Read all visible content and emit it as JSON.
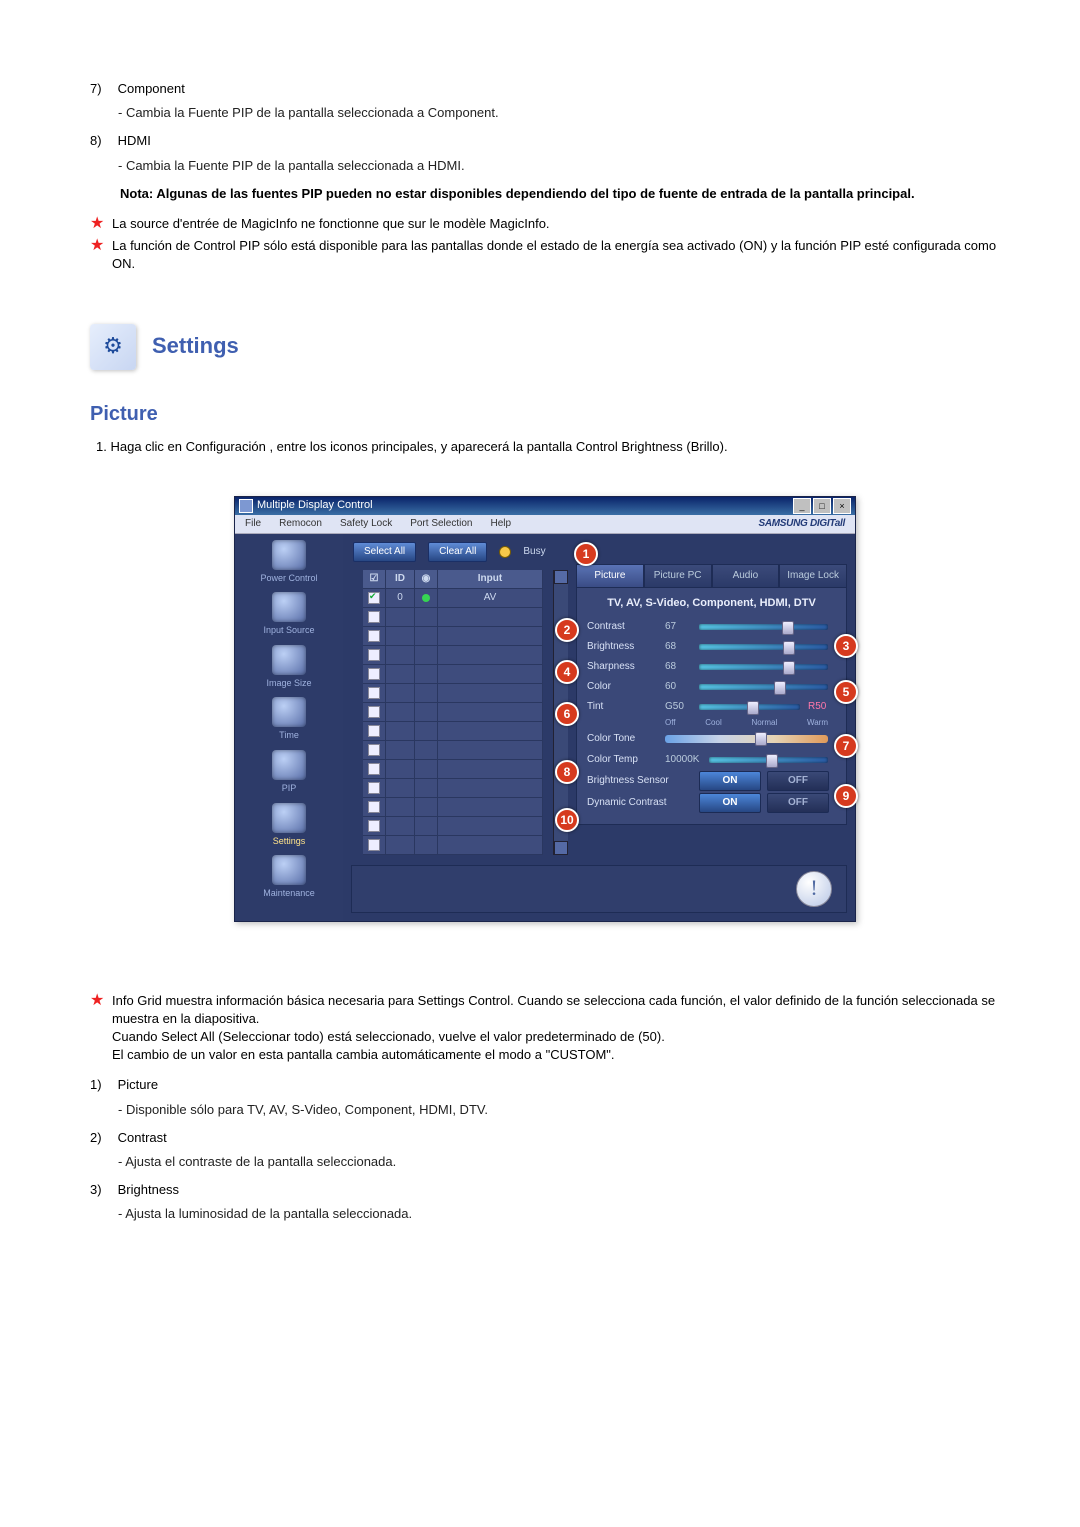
{
  "items7": {
    "num": "7)",
    "label": "Component"
  },
  "items7_desc": "- Cambia la Fuente PIP de la pantalla seleccionada a Component.",
  "items8": {
    "num": "8)",
    "label": "HDMI"
  },
  "items8_desc": "- Cambia la Fuente PIP de la pantalla seleccionada a HDMI.",
  "nota": "Nota: Algunas de las fuentes PIP pueden no estar disponibles dependiendo del tipo de fuente de entrada de la pantalla principal.",
  "star1": "La source d'entrée de MagicInfo ne fonctionne que sur le modèle MagicInfo.",
  "star2": "La función de Control PIP sólo está disponible para las pantallas donde el estado de la energía sea activado (ON) y la función PIP esté configurada como ON.",
  "settings_title": "Settings",
  "picture_title": "Picture",
  "picture_desc_prefix": "1.",
  "picture_desc": "Haga clic en Configuración , entre los iconos principales, y aparecerá la pantalla Control Brightness (Brillo).",
  "app": {
    "title": "Multiple Display Control",
    "brand": "SAMSUNG DIGITall",
    "menu": {
      "file": "File",
      "remocon": "Remocon",
      "safety": "Safety Lock",
      "port": "Port Selection",
      "help": "Help"
    },
    "side": {
      "power": "Power Control",
      "input": "Input Source",
      "image": "Image Size",
      "time": "Time",
      "pip": "PIP",
      "settings": "Settings",
      "maint": "Maintenance"
    },
    "buttons": {
      "selectAll": "Select All",
      "clearAll": "Clear All",
      "busy": "Busy"
    },
    "grid": {
      "h_chk": "☑",
      "h_id": "ID",
      "h_st": "",
      "h_input": "Input",
      "row_id": "0",
      "row_input": "AV"
    },
    "tabs": {
      "picture": "Picture",
      "picturepc": "Picture PC",
      "audio": "Audio",
      "imagelock": "Image Lock"
    },
    "panel": {
      "head": "TV, AV, S-Video, Component, HDMI, DTV",
      "contrast": {
        "lbl": "Contrast",
        "val": "67"
      },
      "brightness": {
        "lbl": "Brightness",
        "val": "68"
      },
      "sharpness": {
        "lbl": "Sharpness",
        "val": "68"
      },
      "color": {
        "lbl": "Color",
        "val": "60"
      },
      "tint": {
        "lbl": "Tint",
        "g": "G50",
        "r": "R50"
      },
      "colortone": {
        "lbl": "Color Tone",
        "off": "Off",
        "cool": "Cool",
        "normal": "Normal",
        "warm": "Warm"
      },
      "colortemp": {
        "lbl": "Color Temp",
        "val": "10000K"
      },
      "brsensor": {
        "lbl": "Brightness Sensor",
        "on": "ON",
        "off": "OFF"
      },
      "dyncontrast": {
        "lbl": "Dynamic Contrast",
        "on": "ON",
        "off": "OFF"
      }
    }
  },
  "after_star": "Info Grid muestra información básica necesaria para Settings Control. Cuando se selecciona cada función, el valor definido de la función seleccionada se muestra en la diapositiva.\nCuando Select All (Seleccionar todo) está seleccionado, vuelve el valor predeterminado de (50).\nEl cambio de un valor en esta pantalla cambia automáticamente el modo a \"CUSTOM\".",
  "a1": {
    "num": "1)",
    "label": "Picture"
  },
  "a1_desc": "- Disponible sólo para TV, AV, S-Video, Component, HDMI, DTV.",
  "a2": {
    "num": "2)",
    "label": "Contrast"
  },
  "a2_desc": "- Ajusta el contraste de la pantalla seleccionada.",
  "a3": {
    "num": "3)",
    "label": "Brightness"
  },
  "a3_desc": "- Ajusta la luminosidad de la pantalla seleccionada."
}
